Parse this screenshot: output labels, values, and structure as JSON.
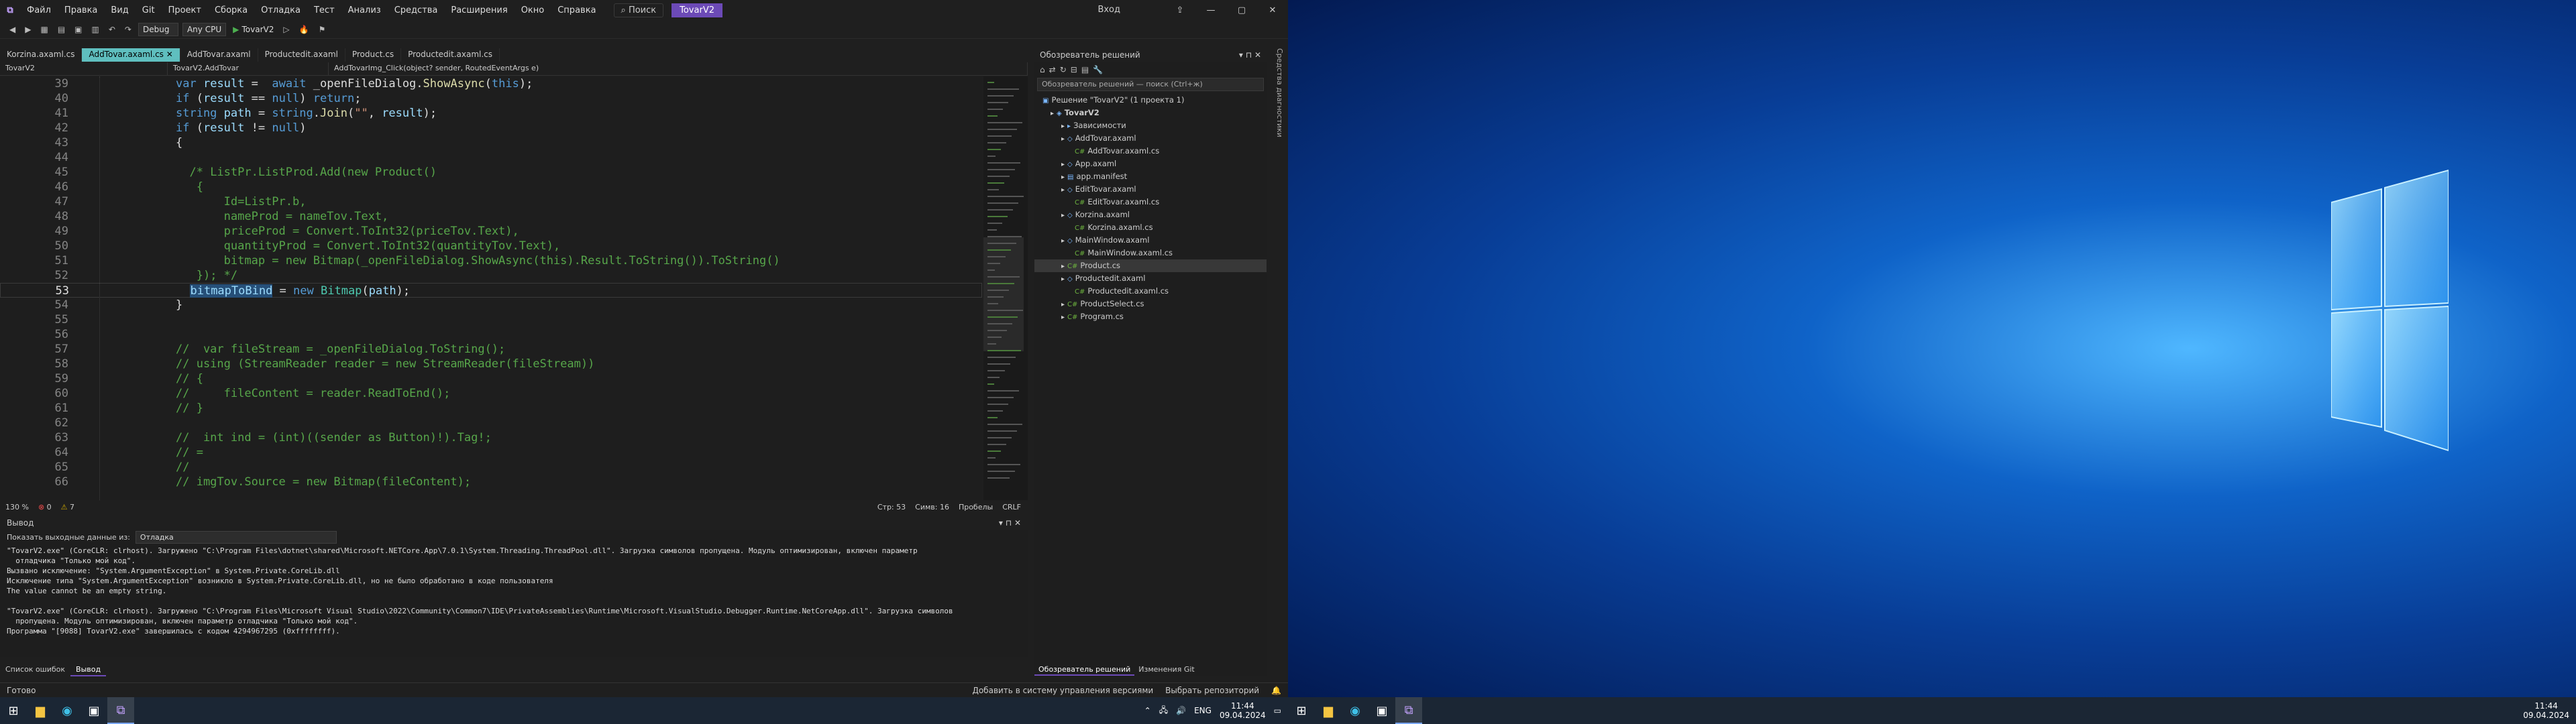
{
  "menu": {
    "items": [
      "Файл",
      "Правка",
      "Вид",
      "Git",
      "Проект",
      "Сборка",
      "Отладка",
      "Тест",
      "Анализ",
      "Средства",
      "Расширения",
      "Окно",
      "Справка"
    ],
    "search_label": "Поиск",
    "solution_name": "TovarV2",
    "signin": "Вход"
  },
  "toolbar": {
    "config": "Debug",
    "platform": "Any CPU",
    "run_target": "TovarV2"
  },
  "tabs": [
    {
      "label": "Korzina.axaml.cs",
      "active": false
    },
    {
      "label": "AddTovar.axaml.cs",
      "active": true
    },
    {
      "label": "AddTovar.axaml",
      "active": false
    },
    {
      "label": "Productedit.axaml",
      "active": false
    },
    {
      "label": "Product.cs",
      "active": false
    },
    {
      "label": "Productedit.axaml.cs",
      "active": false
    }
  ],
  "nav": {
    "project": "TovarV2",
    "class": "TovarV2.AddTovar",
    "member": "AddTovarImg_Click(object? sender, RoutedEventArgs e)"
  },
  "code_lines": [
    {
      "n": "39",
      "html": "<span class=\"k\">var</span> <span class=\"v\">result</span> =  <span class=\"k\">await</span> _openFileDialog.<span class=\"m\">ShowAsync</span>(<span class=\"k\">this</span>);"
    },
    {
      "n": "40",
      "html": "<span class=\"k\">if</span> (<span class=\"v\">result</span> == <span class=\"k\">null</span>) <span class=\"k\">return</span>;"
    },
    {
      "n": "41",
      "html": "<span class=\"k\">string</span> <span class=\"v\">path</span> = <span class=\"k\">string</span>.<span class=\"m\">Join</span>(<span class=\"s\">\"\"</span>, <span class=\"v\">result</span>);"
    },
    {
      "n": "42",
      "html": "<span class=\"k\">if</span> (<span class=\"v\">result</span> != <span class=\"k\">null</span>)"
    },
    {
      "n": "43",
      "html": "{"
    },
    {
      "n": "44",
      "html": ""
    },
    {
      "n": "45",
      "html": "  <span class=\"c\">/* ListPr.ListProd.Add(new Product()</span>"
    },
    {
      "n": "46",
      "html": "  <span class=\"c\"> {</span>"
    },
    {
      "n": "47",
      "html": "  <span class=\"c\">     Id=ListPr.b,</span>"
    },
    {
      "n": "48",
      "html": "  <span class=\"c\">     nameProd = nameTov.Text,</span>"
    },
    {
      "n": "49",
      "html": "  <span class=\"c\">     priceProd = Convert.ToInt32(priceTov.Text),</span>"
    },
    {
      "n": "50",
      "html": "  <span class=\"c\">     quantityProd = Convert.ToInt32(quantityTov.Text),</span>"
    },
    {
      "n": "51",
      "html": "  <span class=\"c\">     bitmap = new Bitmap(_openFileDialog.ShowAsync(this).Result.ToString()).ToString()</span>"
    },
    {
      "n": "52",
      "html": "  <span class=\"c\"> }); */</span>"
    },
    {
      "n": "53",
      "html": "  <span class=\"v\" style=\"background:#264f78\">bitmapToBind</span> = <span class=\"k\">new</span> <span class=\"t\">Bitmap</span>(<span class=\"v\">path</span>);",
      "current": true
    },
    {
      "n": "54",
      "html": "}"
    },
    {
      "n": "55",
      "html": ""
    },
    {
      "n": "56",
      "html": ""
    },
    {
      "n": "57",
      "html": "<span class=\"c\">//  var fileStream = _openFileDialog.ToString();</span>"
    },
    {
      "n": "58",
      "html": "<span class=\"c\">// using (StreamReader reader = new StreamReader(fileStream))</span>"
    },
    {
      "n": "59",
      "html": "<span class=\"c\">// {</span>"
    },
    {
      "n": "60",
      "html": "<span class=\"c\">//     fileContent = reader.ReadToEnd();</span>"
    },
    {
      "n": "61",
      "html": "<span class=\"c\">// }</span>"
    },
    {
      "n": "62",
      "html": ""
    },
    {
      "n": "63",
      "html": "<span class=\"c\">//  int ind = (int)((sender as Button)!).Tag!;</span>"
    },
    {
      "n": "64",
      "html": "<span class=\"c\">// =</span>"
    },
    {
      "n": "65",
      "html": "<span class=\"c\">//</span>"
    },
    {
      "n": "66",
      "html": "<span class=\"c\">// imgTov.Source = new Bitmap(fileContent);</span>"
    }
  ],
  "editor_status": {
    "zoom": "130 %",
    "errors": "0",
    "warnings": "7",
    "line": "Стр: 53",
    "col": "Симв: 16",
    "whitespace": "Пробелы",
    "eol": "CRLF"
  },
  "output": {
    "title": "Вывод",
    "source_label": "Показать выходные данные из:",
    "source_value": "Отладка",
    "lines": [
      "\"TovarV2.exe\" (CoreCLR: clrhost). Загружено \"C:\\Program Files\\dotnet\\shared\\Microsoft.NETCore.App\\7.0.1\\System.Threading.ThreadPool.dll\". Загрузка символов пропущена. Модуль оптимизирован, включен параметр",
      "  отладчика \"Только мой код\".",
      "Вызвано исключение: \"System.ArgumentException\" в System.Private.CoreLib.dll",
      "Исключение типа \"System.ArgumentException\" возникло в System.Private.CoreLib.dll, но не было обработано в коде пользователя",
      "The value cannot be an empty string.",
      "",
      "\"TovarV2.exe\" (CoreCLR: clrhost). Загружено \"C:\\Program Files\\Microsoft Visual Studio\\2022\\Community\\Common7\\IDE\\PrivateAssemblies\\Runtime\\Microsoft.VisualStudio.Debugger.Runtime.NetCoreApp.dll\". Загрузка символов",
      "  пропущена. Модуль оптимизирован, включен параметр отладчика \"Только мой код\".",
      "Программа \"[9088] TovarV2.exe\" завершилась с кодом 4294967295 (0xffffffff)."
    ]
  },
  "bottom_tabs": [
    "Список ошибок",
    "Вывод"
  ],
  "solution": {
    "title": "Обозреватель решений",
    "search": "Обозреватель решений — поиск (Ctrl+ж)",
    "nodes": [
      {
        "label": "Решение \"TovarV2\" (1 проекта 1)",
        "depth": 0,
        "icon": "▣"
      },
      {
        "label": "TovarV2",
        "depth": 1,
        "icon": "◈",
        "bold": true
      },
      {
        "label": "Зависимости",
        "depth": 2,
        "icon": "▸"
      },
      {
        "label": "AddTovar.axaml",
        "depth": 2,
        "icon": "◇"
      },
      {
        "label": "AddTovar.axaml.cs",
        "depth": 3,
        "icon": "C#"
      },
      {
        "label": "App.axaml",
        "depth": 2,
        "icon": "◇"
      },
      {
        "label": "app.manifest",
        "depth": 2,
        "icon": "▤"
      },
      {
        "label": "EditTovar.axaml",
        "depth": 2,
        "icon": "◇"
      },
      {
        "label": "EditTovar.axaml.cs",
        "depth": 3,
        "icon": "C#"
      },
      {
        "label": "Korzina.axaml",
        "depth": 2,
        "icon": "◇"
      },
      {
        "label": "Korzina.axaml.cs",
        "depth": 3,
        "icon": "C#"
      },
      {
        "label": "MainWindow.axaml",
        "depth": 2,
        "icon": "◇"
      },
      {
        "label": "MainWindow.axaml.cs",
        "depth": 3,
        "icon": "C#"
      },
      {
        "label": "Product.cs",
        "depth": 2,
        "icon": "C#",
        "selected": true
      },
      {
        "label": "Productedit.axaml",
        "depth": 2,
        "icon": "◇"
      },
      {
        "label": "Productedit.axaml.cs",
        "depth": 3,
        "icon": "C#"
      },
      {
        "label": "ProductSelect.cs",
        "depth": 2,
        "icon": "C#"
      },
      {
        "label": "Program.cs",
        "depth": 2,
        "icon": "C#"
      }
    ],
    "tabs": [
      "Обозреватель решений",
      "Изменения Git"
    ]
  },
  "diag_label": "Средства диагностики",
  "status": {
    "ready": "Готово",
    "add_vcs": "Добавить в систему управления версиями",
    "select_repo": "Выбрать репозиторий"
  },
  "taskbar": {
    "lang": "ENG",
    "time": "11:44",
    "date": "09.04.2024"
  },
  "colors": {
    "accent": "#6c4ab7",
    "active_tab": "#5fbfbf",
    "editor_bg": "#1e1e1e"
  }
}
